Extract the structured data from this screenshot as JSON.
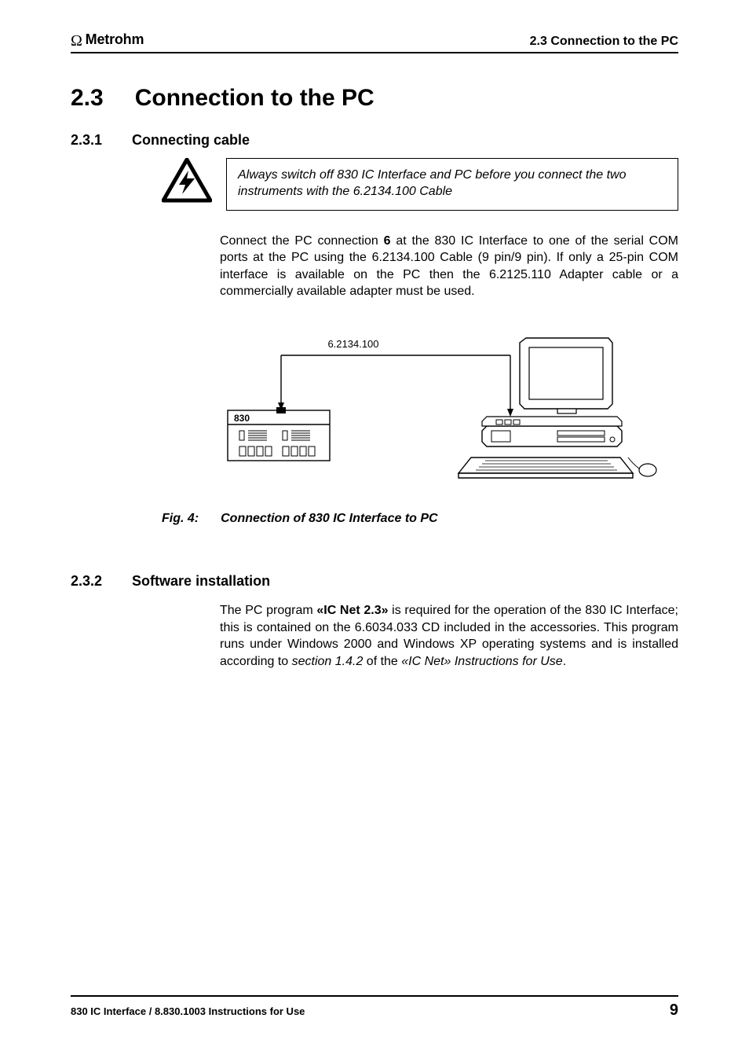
{
  "header": {
    "brand": "Metrohm",
    "right": "2.3 Connection to the PC"
  },
  "section": {
    "number": "2.3",
    "title": "Connection to the PC"
  },
  "sub1": {
    "number": "2.3.1",
    "title": "Connecting cable",
    "warning": "Always switch off 830 IC Interface and PC before you connect the two instruments with the 6.2134.100 Cable",
    "p1_a": "Connect the PC connection ",
    "p1_bold": "6",
    "p1_b": " at the 830 IC Interface to one of the serial COM ports at the PC using the 6.2134.100 Cable (9 pin/9 pin). If only a 25-pin COM interface is available on the PC then the 6.2125.110 Adapter cable or a commercially available adapter must be used."
  },
  "figure": {
    "cable_label": "6.2134.100",
    "device_label": "830",
    "caption_label": "Fig. 4:",
    "caption_text": "Connection of 830 IC Interface to PC"
  },
  "sub2": {
    "number": "2.3.2",
    "title": "Software installation",
    "p_a": "The PC program ",
    "p_bold": "«IC Net 2.3»",
    "p_b": " is required for the operation of the 830 IC Interface; this is contained on the 6.6034.033 CD included in the accessories. This program runs under Windows 2000 and Windows XP operating systems and is installed according to ",
    "p_ital1": "section 1.4.2",
    "p_c": " of the ",
    "p_ital2": "«IC Net» Instructions for Use",
    "p_d": "."
  },
  "footer": {
    "left": "830 IC Interface / 8.830.1003 Instructions for Use",
    "page": "9"
  }
}
